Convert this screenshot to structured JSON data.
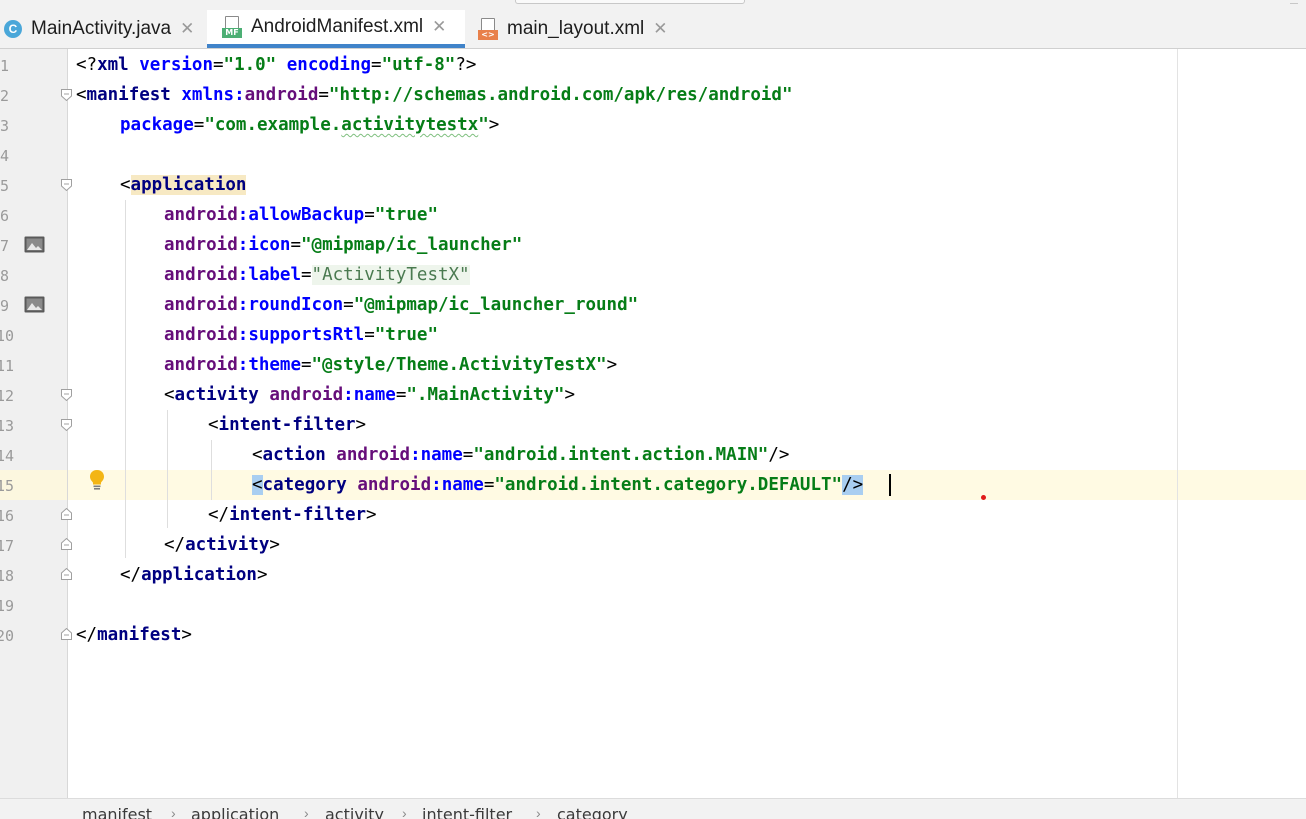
{
  "tabs": [
    {
      "label": "MainActivity.java",
      "icon": "java-class-icon",
      "icon_glyph": "C",
      "active": false
    },
    {
      "label": "AndroidManifest.xml",
      "icon": "manifest-file-icon",
      "icon_badge": "MF",
      "active": true
    },
    {
      "label": "main_layout.xml",
      "icon": "layout-file-icon",
      "icon_badge": "<>",
      "active": false
    }
  ],
  "tab_close_glyph": "✕",
  "editor": {
    "line_numbers": [
      "1",
      "2",
      "3",
      "4",
      "5",
      "6",
      "7",
      "8",
      "9",
      "10",
      "11",
      "12",
      "13",
      "14",
      "15",
      "16",
      "17",
      "18",
      "19",
      "20"
    ],
    "current_line": 15,
    "lines": {
      "l1": {
        "p1": "<?",
        "t1": "xml",
        "a1": " version",
        "e1": "=",
        "v1": "\"1.0\"",
        "a2": " encoding",
        "e2": "=",
        "v2": "\"utf-8\"",
        "p2": "?>"
      },
      "l2": {
        "p1": "<",
        "t1": "manifest",
        "a1": " xmlns",
        "c1": ":",
        "n1": "android",
        "e1": "=",
        "v1": "\"http://schemas.android.com/apk/res/android\""
      },
      "l3": {
        "a1": "package",
        "e1": "=",
        "v1a": "\"com.example.",
        "v1b": "activitytestx",
        "v1c": "\"",
        "p1": ">"
      },
      "l5": {
        "p1": "<",
        "t1": "application"
      },
      "l6": {
        "n1": "android",
        "c1": ":",
        "a1": "allowBackup",
        "e1": "=",
        "v1": "\"true\""
      },
      "l7": {
        "n1": "android",
        "c1": ":",
        "a1": "icon",
        "e1": "=",
        "v1": "\"@mipmap/ic_launcher\""
      },
      "l8": {
        "n1": "android",
        "c1": ":",
        "a1": "label",
        "e1": "=",
        "v1": "\"ActivityTestX\""
      },
      "l9": {
        "n1": "android",
        "c1": ":",
        "a1": "roundIcon",
        "e1": "=",
        "v1": "\"@mipmap/ic_launcher_round\""
      },
      "l10": {
        "n1": "android",
        "c1": ":",
        "a1": "supportsRtl",
        "e1": "=",
        "v1": "\"true\""
      },
      "l11": {
        "n1": "android",
        "c1": ":",
        "a1": "theme",
        "e1": "=",
        "v1": "\"@style/Theme.ActivityTestX\"",
        "p1": ">"
      },
      "l12": {
        "p1": "<",
        "t1": "activity",
        "n1": " android",
        "c1": ":",
        "a1": "name",
        "e1": "=",
        "v1": "\".MainActivity\"",
        "p2": ">"
      },
      "l13": {
        "p1": "<",
        "t1": "intent-filter",
        "p2": ">"
      },
      "l14": {
        "p1": "<",
        "t1": "action",
        "n1": " android",
        "c1": ":",
        "a1": "name",
        "e1": "=",
        "v1": "\"android.intent.action.MAIN\"",
        "p2": "/>"
      },
      "l15": {
        "p1": "<",
        "t1": "category",
        "n1": " android",
        "c1": ":",
        "a1": "name",
        "e1": "=",
        "v1": "\"android.intent.category.DEFAULT\"",
        "p2": "/>"
      },
      "l16": {
        "p1": "</",
        "t1": "intent-filter",
        "p2": ">"
      },
      "l17": {
        "p1": "</",
        "t1": "activity",
        "p2": ">"
      },
      "l18": {
        "p1": "</",
        "t1": "application",
        "p2": ">"
      },
      "l20": {
        "p1": "</",
        "t1": "manifest",
        "p2": ">"
      }
    }
  },
  "breadcrumb": [
    "manifest",
    "application",
    "activity",
    "intent-filter",
    "category"
  ],
  "breadcrumb_sep": "›",
  "colors": {
    "tag": "#000080",
    "attribute": "#0000ff",
    "namespace": "#660e7a",
    "value": "#067d17",
    "current_line": "#fffae3",
    "active_tab_underline": "#4083c9"
  }
}
